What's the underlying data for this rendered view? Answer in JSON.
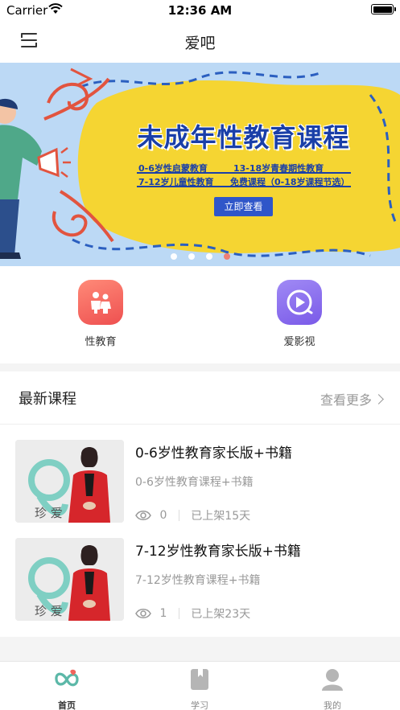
{
  "status_bar": {
    "carrier": "Carrier",
    "time": "12:36 AM"
  },
  "nav": {
    "title": "爱吧",
    "menu_icon": "menu-icon"
  },
  "banner": {
    "title": "未成年性教育课程",
    "line1_left": "0-6岁性启蒙教育",
    "line1_right": "13-18岁青春期性教育",
    "line2_left": "7-12岁儿童性教育",
    "line2_right": "免费课程（0-18岁课程节选）",
    "button": "立即查看",
    "page_count": 4,
    "active_page": 4
  },
  "quick_entries": [
    {
      "label": "性教育",
      "icon": "family-icon",
      "color": "#f0645c"
    },
    {
      "label": "爱影视",
      "icon": "play-icon",
      "color": "#8c6cf0"
    }
  ],
  "latest": {
    "title": "最新课程",
    "more": "查看更多",
    "courses": [
      {
        "title": "0-6岁性教育家长版+书籍",
        "subtitle": "0-6岁性教育课程+书籍",
        "views": "0",
        "shelf": "已上架15天",
        "thumb_caption": "珍 爱"
      },
      {
        "title": "7-12岁性教育家长版+书籍",
        "subtitle": "7-12岁性教育课程+书籍",
        "views": "1",
        "shelf": "已上架23天",
        "thumb_caption": "珍 爱"
      }
    ]
  },
  "tabs": [
    {
      "label": "首页",
      "icon": "home-icon",
      "active": true
    },
    {
      "label": "学习",
      "icon": "book-icon",
      "active": false
    },
    {
      "label": "我的",
      "icon": "profile-icon",
      "active": false
    }
  ],
  "colors": {
    "accent_teal": "#5cb8a8",
    "accent_red": "#f0645c",
    "banner_blue": "#1a3fa8",
    "banner_yellow": "#f5d532"
  }
}
